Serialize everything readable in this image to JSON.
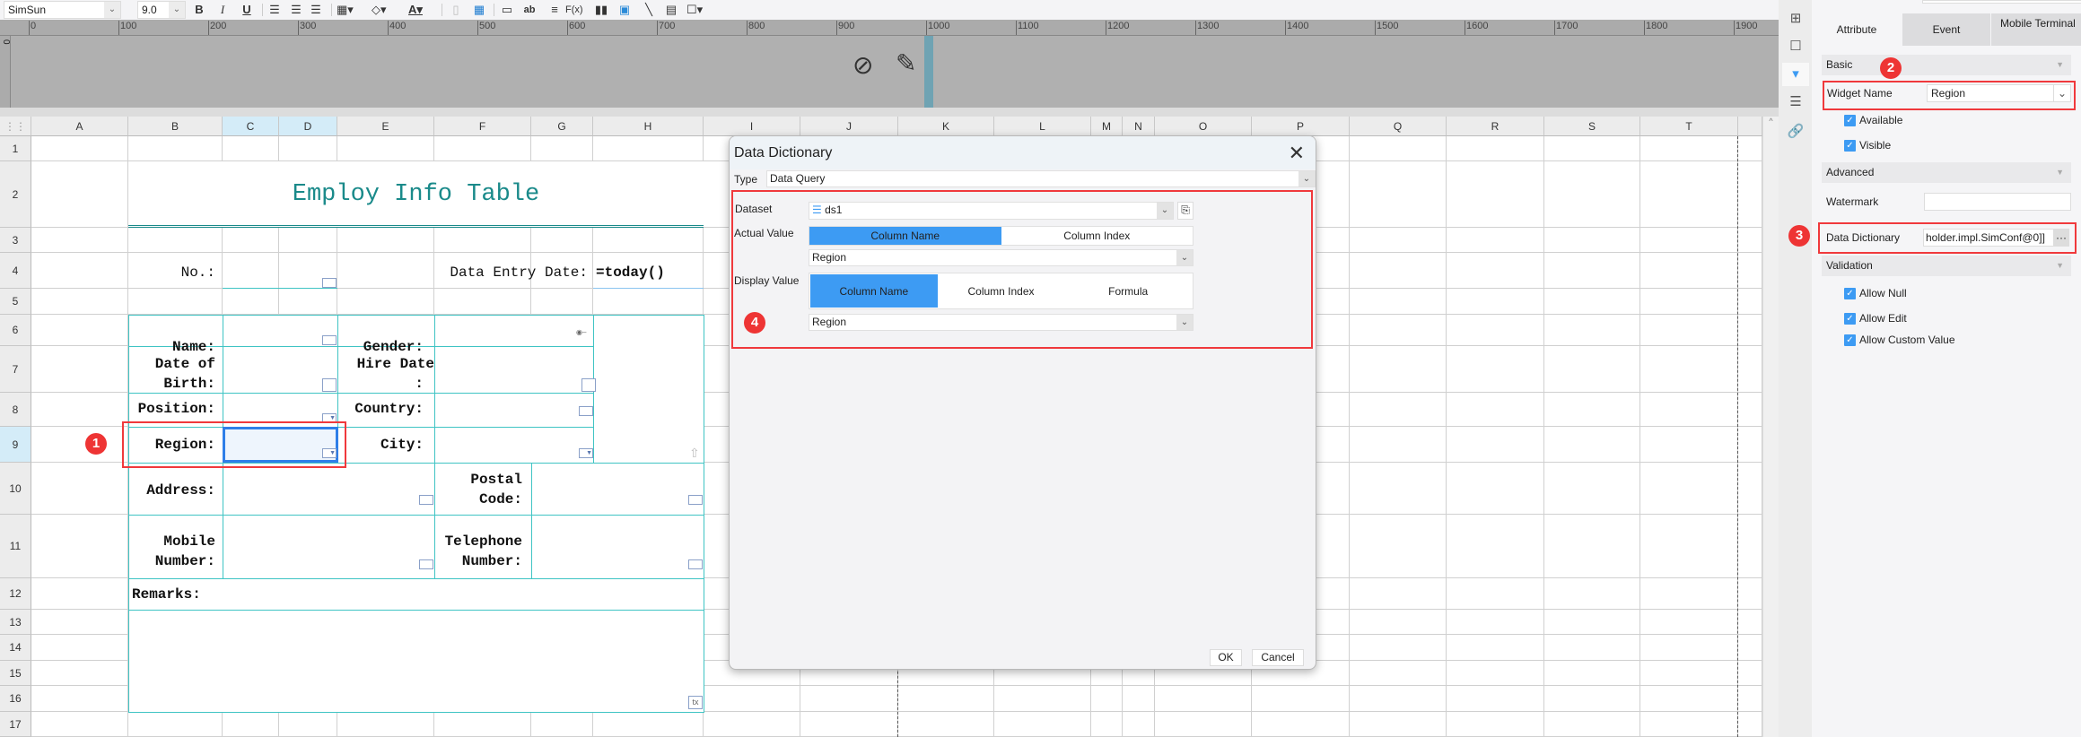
{
  "toolbar": {
    "font_family": "SimSun",
    "font_size": "9.0",
    "bold": "B",
    "italic": "I",
    "underline": "U",
    "font_color_glyph": "A",
    "text_widget_glyph": "ab",
    "formula_glyph": "F(x)"
  },
  "ruler": {
    "labels": [
      "0",
      "100",
      "200",
      "300",
      "400",
      "500",
      "600",
      "700",
      "800",
      "900",
      "1000",
      "1100",
      "1200",
      "1300",
      "1400",
      "1500",
      "1600",
      "1700",
      "1800",
      "1900"
    ],
    "vertical_label": "0"
  },
  "sheet": {
    "columns": [
      "A",
      "B",
      "C",
      "D",
      "E",
      "F",
      "G",
      "H",
      "I",
      "J",
      "K",
      "L",
      "M",
      "N",
      "O",
      "P",
      "Q",
      "R",
      "S",
      "T"
    ],
    "rows": [
      "1",
      "2",
      "3",
      "4",
      "5",
      "6",
      "7",
      "8",
      "9",
      "10",
      "11",
      "12",
      "13",
      "14",
      "15",
      "16",
      "17"
    ],
    "selected_columns": [
      "C",
      "D"
    ],
    "selected_row": "9",
    "title": "Employ Info Table",
    "labels": {
      "no": "No.:",
      "entry_date": "Data Entry Date:",
      "entry_date_value": "=today()",
      "name": "Name:",
      "gender": "Gender:",
      "dob_1": "Date of",
      "dob_2": "Birth:",
      "hire_1": "Hire Date",
      "hire_2": ":",
      "position": "Position:",
      "country": "Country:",
      "region": "Region:",
      "city": "City:",
      "address": "Address:",
      "postal_1": "Postal",
      "postal_2": "Code:",
      "mobile_1": "Mobile",
      "mobile_2": "Number:",
      "tel_1": "Telephone",
      "tel_2": "Number:",
      "remarks": "Remarks:",
      "textarea_marker": "tx"
    },
    "accent_color": "#1a8a8a"
  },
  "badges": [
    "1",
    "2",
    "3",
    "4"
  ],
  "dialog": {
    "title": "Data Dictionary",
    "type_label": "Type",
    "type_value": "Data Query",
    "dataset_label": "Dataset",
    "dataset_value": "ds1",
    "actual_value_label": "Actual Value",
    "actual_tabs": [
      "Column Name",
      "Column Index"
    ],
    "actual_value": "Region",
    "display_value_label": "Display Value",
    "display_tabs": [
      "Column Name",
      "Column Index",
      "Formula"
    ],
    "display_value": "Region",
    "ok": "OK",
    "cancel": "Cancel"
  },
  "panel": {
    "tabs": [
      "Attribute",
      "Event",
      "Mobile Terminal"
    ],
    "basic": "Basic",
    "widget_name_label": "Widget Name",
    "widget_name_value": "Region",
    "available": "Available",
    "visible": "Visible",
    "advanced": "Advanced",
    "watermark": "Watermark",
    "data_dictionary_label": "Data Dictionary",
    "data_dictionary_value": "holder.impl.SimConf@0]]",
    "dict_button": "···",
    "validation": "Validation",
    "allow_null": "Allow Null",
    "allow_edit": "Allow Edit",
    "allow_custom": "Allow Custom Value"
  }
}
